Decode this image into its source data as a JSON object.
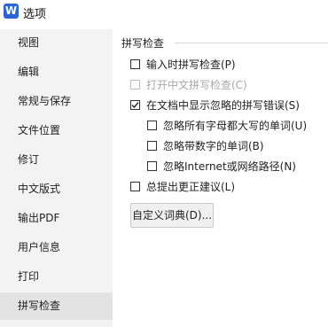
{
  "window": {
    "title": "选项",
    "app_icon_letter": "W"
  },
  "sidebar": {
    "items": [
      {
        "label": "视图"
      },
      {
        "label": "编辑"
      },
      {
        "label": "常规与保存"
      },
      {
        "label": "文件位置"
      },
      {
        "label": "修订"
      },
      {
        "label": "中文版式"
      },
      {
        "label": "输出PDF"
      },
      {
        "label": "用户信息"
      },
      {
        "label": "打印"
      },
      {
        "label": "拼写检查",
        "selected": true
      }
    ]
  },
  "spellcheck": {
    "section_title": "拼写检查",
    "options": [
      {
        "label": "输入时拼写检查(P)",
        "checked": false,
        "enabled": true
      },
      {
        "label": "打开中文拼写检查(C)",
        "checked": false,
        "enabled": false
      },
      {
        "label": "在文档中显示忽略的拼写错误(S)",
        "checked": true,
        "enabled": true
      },
      {
        "label": "忽略所有字母都大写的单词(U)",
        "checked": false,
        "enabled": true
      },
      {
        "label": "忽略带数字的单词(B)",
        "checked": false,
        "enabled": true
      },
      {
        "label": "忽略Internet或网络路径(N)",
        "checked": false,
        "enabled": true
      },
      {
        "label": "总提出更正建议(L)",
        "checked": false,
        "enabled": true
      }
    ],
    "custom_dictionary_button": "自定义词典(D)..."
  }
}
